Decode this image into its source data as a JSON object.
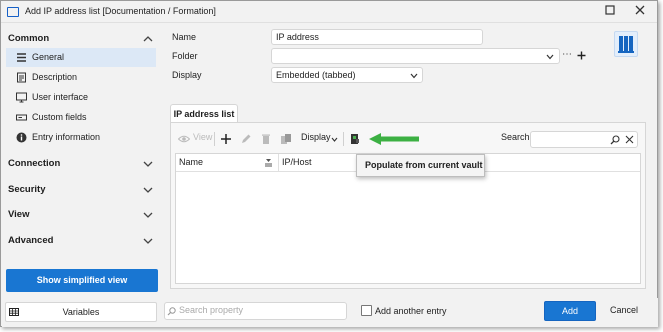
{
  "window": {
    "title": "Add IP address list [Documentation / Formation]"
  },
  "sidebar": {
    "sections": [
      {
        "label": "Common",
        "expanded": true
      },
      {
        "label": "Connection",
        "expanded": false
      },
      {
        "label": "Security",
        "expanded": false
      },
      {
        "label": "View",
        "expanded": false
      },
      {
        "label": "Advanced",
        "expanded": false
      }
    ],
    "common_items": [
      {
        "label": "General",
        "icon": "list-icon",
        "selected": true
      },
      {
        "label": "Description",
        "icon": "description-icon",
        "selected": false
      },
      {
        "label": "User interface",
        "icon": "monitor-icon",
        "selected": false
      },
      {
        "label": "Custom fields",
        "icon": "custom-fields-icon",
        "selected": false
      },
      {
        "label": "Entry information",
        "icon": "info-icon",
        "selected": false
      }
    ],
    "simplified_button": "Show simplified view"
  },
  "form": {
    "name_label": "Name",
    "name_value": "IP address",
    "folder_label": "Folder",
    "folder_value": "",
    "display_label": "Display",
    "display_value": "Embedded (tabbed)"
  },
  "tabs": [
    {
      "label": "IP address list",
      "active": true
    }
  ],
  "toolbar": {
    "view_label": "View",
    "display_label": "Display",
    "search_label": "Search",
    "search_value": ""
  },
  "grid": {
    "columns": [
      "Name",
      "IP/Host"
    ],
    "rows": []
  },
  "tooltip": {
    "text": "Populate from current vault"
  },
  "footer": {
    "variables_label": "Variables",
    "search_property_placeholder": "Search property",
    "add_another_label": "Add another entry",
    "add_another_checked": false,
    "add_button": "Add",
    "cancel_button": "Cancel"
  },
  "colors": {
    "accent": "#1976d2",
    "selected_bg": "#dce8f6",
    "arrow_green": "#3cb043"
  }
}
